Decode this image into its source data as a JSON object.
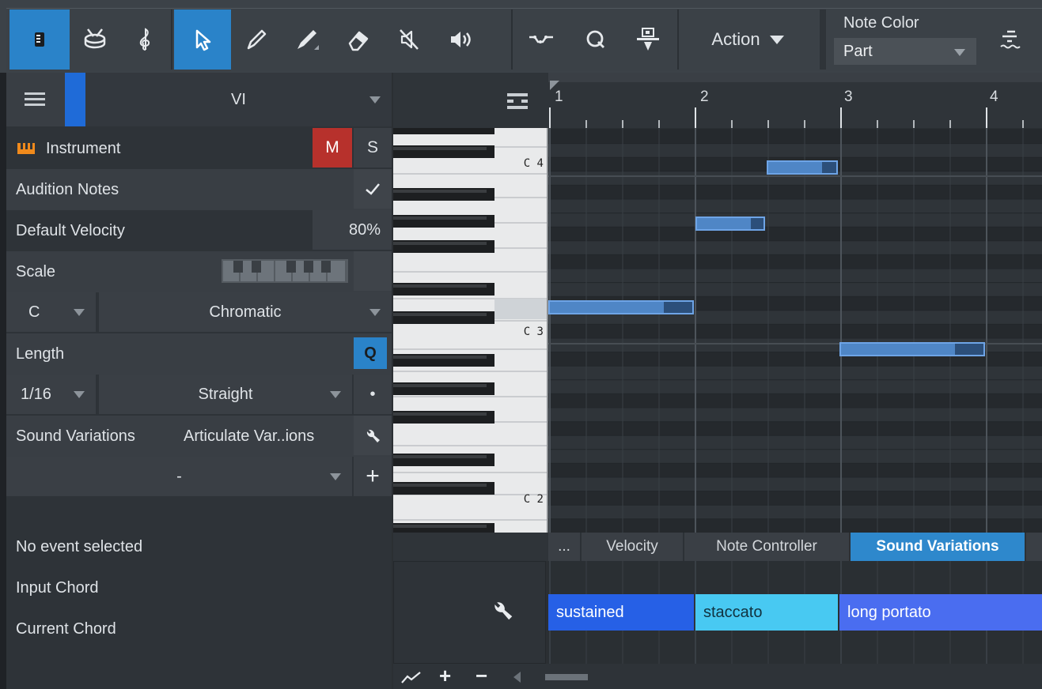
{
  "toolbar": {
    "action_label": "Action",
    "note_color_label": "Note Color",
    "note_color_value": "Part",
    "accent": "#2a83c9",
    "tools": [
      "inspector-icon",
      "drum-icon",
      "treble-clef-icon",
      "arrow-icon",
      "pencil-icon",
      "paint-brush-icon",
      "eraser-icon",
      "mute-icon",
      "speaker-icon",
      "bend-icon",
      "quantize-icon",
      "split-icon",
      "expand-icon"
    ]
  },
  "inspector": {
    "track_name": "VI",
    "instrument_label": "Instrument",
    "mute_label": "M",
    "solo_label": "S",
    "audition_label": "Audition Notes",
    "default_velocity_label": "Default Velocity",
    "default_velocity_value": "80%",
    "scale_label": "Scale",
    "scale_root": "C",
    "scale_type": "Chromatic",
    "length_label": "Length",
    "length_q": "Q",
    "length_value": "1/16",
    "length_mode": "Straight",
    "length_dot": "•",
    "sound_variations_label": "Sound Variations",
    "sound_variations_value": "Articulate Var..ions",
    "variation_select": "-",
    "add_label": "+",
    "no_event": "No event selected",
    "input_chord": "Input Chord",
    "current_chord": "Current Chord",
    "mute_color": "#b7312c"
  },
  "keyboard": {
    "labels": [
      "C 4",
      "C 3",
      "C 2"
    ]
  },
  "ruler": {
    "bars": [
      "1",
      "2",
      "3",
      "4"
    ]
  },
  "lane_tabs": {
    "more": "...",
    "velocity": "Velocity",
    "note_controller": "Note Controller",
    "sound_variations": "Sound Variations"
  },
  "sound_variations": {
    "blocks": [
      "sustained",
      "staccato",
      "long portato"
    ],
    "colors": [
      "#2660e6",
      "#48c9f2",
      "#4a6df0"
    ]
  },
  "bottom": {
    "plus": "+",
    "minus": "−"
  }
}
